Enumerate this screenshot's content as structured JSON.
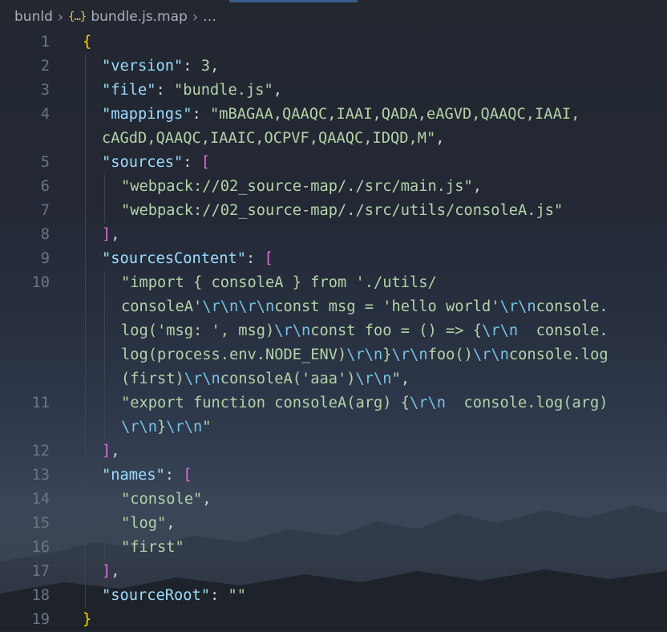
{
  "breadcrumb": {
    "root": "bunld",
    "file": "bundle.js.map",
    "ellipsis": "…",
    "file_icon": "json-braces-icon",
    "separator_icon": "chevron-right-icon"
  },
  "colors": {
    "key": "#9cdcfe",
    "string": "#b5d3a7",
    "escape": "#77c3e6",
    "number": "#b5cea8",
    "brace": "#ffd700",
    "bracket": "#da70d6",
    "line_number": "#6b7585"
  },
  "lines": [
    {
      "num": "1",
      "segments": [
        {
          "t": "{",
          "c": "b1"
        }
      ]
    },
    {
      "num": "2",
      "segments": [
        {
          "t": "\"version\"",
          "c": "k"
        },
        {
          "t": ": ",
          "c": "p"
        },
        {
          "t": "3",
          "c": "n"
        },
        {
          "t": ",",
          "c": "p"
        }
      ]
    },
    {
      "num": "3",
      "segments": [
        {
          "t": "\"file\"",
          "c": "k"
        },
        {
          "t": ": ",
          "c": "p"
        },
        {
          "t": "\"bundle.js\"",
          "c": "s"
        },
        {
          "t": ",",
          "c": "p"
        }
      ]
    },
    {
      "num": "4",
      "segments": [
        {
          "t": "\"mappings\"",
          "c": "k"
        },
        {
          "t": ": ",
          "c": "p"
        },
        {
          "t": "\"mBAGAA,QAAQC,IAAI,QADA,eAGVD,QAAQC,IAAI,",
          "c": "s"
        }
      ]
    },
    {
      "num": "",
      "segments": [
        {
          "t": "cAGdD,QAAQC,IAAIC,OCPVF,QAAQC,IDQD,M\"",
          "c": "s"
        },
        {
          "t": ",",
          "c": "p"
        }
      ]
    },
    {
      "num": "5",
      "segments": [
        {
          "t": "\"sources\"",
          "c": "k"
        },
        {
          "t": ": ",
          "c": "p"
        },
        {
          "t": "[",
          "c": "b2"
        }
      ]
    },
    {
      "num": "6",
      "segments": [
        {
          "t": "\"webpack://02_source-map/./src/main.js\"",
          "c": "s"
        },
        {
          "t": ",",
          "c": "p"
        }
      ]
    },
    {
      "num": "7",
      "segments": [
        {
          "t": "\"webpack://02_source-map/./src/utils/consoleA.js\"",
          "c": "s"
        }
      ]
    },
    {
      "num": "8",
      "segments": [
        {
          "t": "]",
          "c": "b2"
        },
        {
          "t": ",",
          "c": "p"
        }
      ]
    },
    {
      "num": "9",
      "segments": [
        {
          "t": "\"sourcesContent\"",
          "c": "k"
        },
        {
          "t": ": ",
          "c": "p"
        },
        {
          "t": "[",
          "c": "b2"
        }
      ]
    },
    {
      "num": "10",
      "segments": [
        {
          "t": "\"import { consoleA } from './utils/",
          "c": "s"
        }
      ]
    },
    {
      "num": "",
      "segments": [
        {
          "t": "consoleA'",
          "c": "s"
        },
        {
          "t": "\\r\\n\\r\\n",
          "c": "esc"
        },
        {
          "t": "const msg = 'hello world'",
          "c": "s"
        },
        {
          "t": "\\r\\n",
          "c": "esc"
        },
        {
          "t": "console.",
          "c": "s"
        }
      ]
    },
    {
      "num": "",
      "segments": [
        {
          "t": "log('msg: ', msg)",
          "c": "s"
        },
        {
          "t": "\\r\\n",
          "c": "esc"
        },
        {
          "t": "const foo = () => {",
          "c": "s"
        },
        {
          "t": "\\r\\n",
          "c": "esc"
        },
        {
          "t": "  console.",
          "c": "s"
        }
      ]
    },
    {
      "num": "",
      "segments": [
        {
          "t": "log(process.env.NODE_ENV)",
          "c": "s"
        },
        {
          "t": "\\r\\n",
          "c": "esc"
        },
        {
          "t": "}",
          "c": "s"
        },
        {
          "t": "\\r\\n",
          "c": "esc"
        },
        {
          "t": "foo()",
          "c": "s"
        },
        {
          "t": "\\r\\n",
          "c": "esc"
        },
        {
          "t": "console.log",
          "c": "s"
        }
      ]
    },
    {
      "num": "",
      "segments": [
        {
          "t": "(first)",
          "c": "s"
        },
        {
          "t": "\\r\\n",
          "c": "esc"
        },
        {
          "t": "consoleA('aaa')",
          "c": "s"
        },
        {
          "t": "\\r\\n",
          "c": "esc"
        },
        {
          "t": "\"",
          "c": "s"
        },
        {
          "t": ",",
          "c": "p"
        }
      ]
    },
    {
      "num": "11",
      "segments": [
        {
          "t": "\"export function consoleA(arg) {",
          "c": "s"
        },
        {
          "t": "\\r\\n",
          "c": "esc"
        },
        {
          "t": "  console.log(arg)",
          "c": "s"
        }
      ]
    },
    {
      "num": "",
      "segments": [
        {
          "t": "\\r\\n",
          "c": "esc"
        },
        {
          "t": "}",
          "c": "s"
        },
        {
          "t": "\\r\\n",
          "c": "esc"
        },
        {
          "t": "\"",
          "c": "s"
        }
      ]
    },
    {
      "num": "12",
      "segments": [
        {
          "t": "]",
          "c": "b2"
        },
        {
          "t": ",",
          "c": "p"
        }
      ]
    },
    {
      "num": "13",
      "segments": [
        {
          "t": "\"names\"",
          "c": "k"
        },
        {
          "t": ": ",
          "c": "p"
        },
        {
          "t": "[",
          "c": "b2"
        }
      ]
    },
    {
      "num": "14",
      "segments": [
        {
          "t": "\"console\"",
          "c": "s"
        },
        {
          "t": ",",
          "c": "p"
        }
      ]
    },
    {
      "num": "15",
      "segments": [
        {
          "t": "\"log\"",
          "c": "s"
        },
        {
          "t": ",",
          "c": "p"
        }
      ]
    },
    {
      "num": "16",
      "segments": [
        {
          "t": "\"first\"",
          "c": "s"
        }
      ]
    },
    {
      "num": "17",
      "segments": [
        {
          "t": "]",
          "c": "b2"
        },
        {
          "t": ",",
          "c": "p"
        }
      ]
    },
    {
      "num": "18",
      "segments": [
        {
          "t": "\"sourceRoot\"",
          "c": "k"
        },
        {
          "t": ": ",
          "c": "p"
        },
        {
          "t": "\"\"",
          "c": "s"
        }
      ]
    },
    {
      "num": "19",
      "segments": [
        {
          "t": "}",
          "c": "b1"
        }
      ]
    }
  ]
}
